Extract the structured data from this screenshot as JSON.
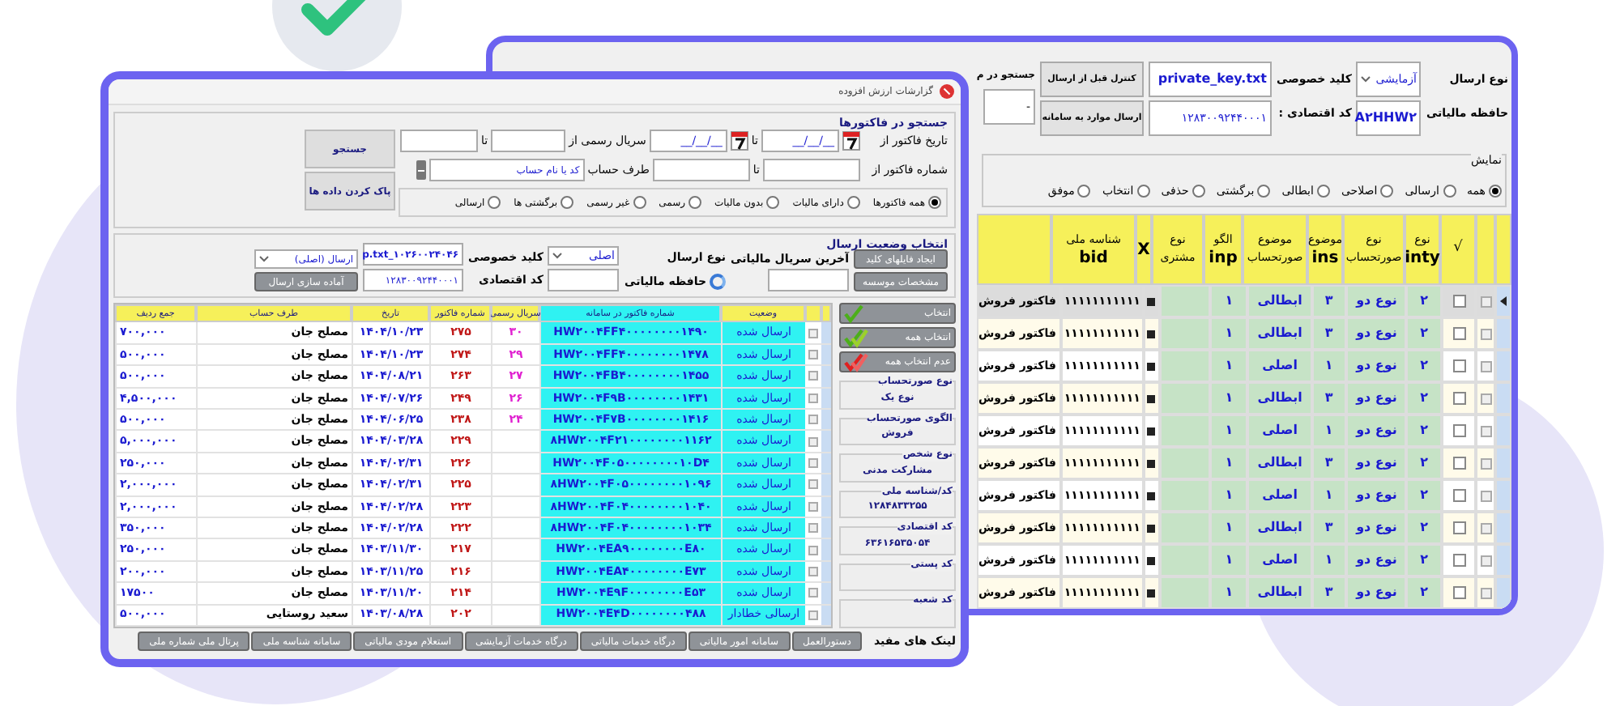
{
  "back_window": {
    "send_type": {
      "label": "نوع ارسال",
      "value": "آزمایشی"
    },
    "tax_memory": {
      "label": "حافظه مالیاتی",
      "value": "A۲HHW۲"
    },
    "private_key": {
      "label": "کلید خصوصی",
      "value": "private_key.txt"
    },
    "economic_code": {
      "label": "کد اقتصادی :",
      "value": "۱۲۸۳۰۰۹۲۴۴۰۰۰۱"
    },
    "buttons": [
      "کنترل قبل از ارسال",
      "ارسال موارد به سامانه"
    ],
    "search": {
      "label": "جستجو در م",
      "value": "-"
    },
    "display": {
      "title": "نمایش",
      "options": [
        {
          "label": "همه",
          "selected": true
        },
        {
          "label": "ارسالی",
          "selected": false
        },
        {
          "label": "اصلاحی",
          "selected": false
        },
        {
          "label": "ابطالی",
          "selected": false
        },
        {
          "label": "برگشتی",
          "selected": false
        },
        {
          "label": "حذفی",
          "selected": false
        },
        {
          "label": "انتخاب",
          "selected": false
        },
        {
          "label": "موفق",
          "selected": false
        }
      ]
    },
    "table": {
      "check_header": "√",
      "columns": [
        {
          "line1": "نوع",
          "code": "inty"
        },
        {
          "line1": "نوع",
          "line2": "صورتحساب"
        },
        {
          "line1": "موضوع",
          "code": "ins"
        },
        {
          "line1": "موضوع",
          "line2": "صورتحساب"
        },
        {
          "line1": "الگو",
          "code": "inp"
        },
        {
          "line1": "نوع",
          "line2": "مشتری"
        },
        {
          "code": "X"
        },
        {
          "line1": "شناسه ملی",
          "code": "bid"
        }
      ],
      "rows": [
        {
          "selected": true,
          "checked": false,
          "cells": [
            "۲",
            "نوع دو",
            "۳",
            "ابطالی",
            "۱",
            "",
            "",
            "۱۱۱۱۱۱۱۱۱۱۱",
            "فاکتور فروش"
          ]
        },
        {
          "selected": false,
          "checked": false,
          "cells": [
            "۲",
            "نوع دو",
            "۳",
            "ابطالی",
            "۱",
            "",
            "",
            "۱۱۱۱۱۱۱۱۱۱۱",
            "فاکتور فروش"
          ]
        },
        {
          "selected": false,
          "checked": false,
          "cells": [
            "۲",
            "نوع دو",
            "۱",
            "اصلی",
            "۱",
            "",
            "",
            "۱۱۱۱۱۱۱۱۱۱۱",
            "فاکتور فروش"
          ]
        },
        {
          "selected": false,
          "checked": false,
          "cells": [
            "۲",
            "نوع دو",
            "۳",
            "ابطالی",
            "۱",
            "",
            "",
            "۱۱۱۱۱۱۱۱۱۱۱",
            "فاکتور فروش"
          ]
        },
        {
          "selected": false,
          "checked": false,
          "cells": [
            "۲",
            "نوع دو",
            "۱",
            "اصلی",
            "۱",
            "",
            "",
            "۱۱۱۱۱۱۱۱۱۱۱",
            "فاکتور فروش"
          ]
        },
        {
          "selected": false,
          "checked": false,
          "cells": [
            "۲",
            "نوع دو",
            "۳",
            "ابطالی",
            "۱",
            "",
            "",
            "۱۱۱۱۱۱۱۱۱۱۱",
            "فاکتور فروش"
          ]
        },
        {
          "selected": false,
          "checked": false,
          "cells": [
            "۲",
            "نوع دو",
            "۱",
            "اصلی",
            "۱",
            "",
            "",
            "۱۱۱۱۱۱۱۱۱۱۱",
            "فاکتور فروش"
          ]
        },
        {
          "selected": false,
          "checked": false,
          "cells": [
            "۲",
            "نوع دو",
            "۳",
            "ابطالی",
            "۱",
            "",
            "",
            "۱۱۱۱۱۱۱۱۱۱۱",
            "فاکتور فروش"
          ]
        },
        {
          "selected": false,
          "checked": false,
          "cells": [
            "۲",
            "نوع دو",
            "۱",
            "اصلی",
            "۱",
            "",
            "",
            "۱۱۱۱۱۱۱۱۱۱۱",
            "فاکتور فروش"
          ]
        },
        {
          "selected": false,
          "checked": false,
          "cells": [
            "۲",
            "نوع دو",
            "۳",
            "ابطالی",
            "۱",
            "",
            "",
            "۱۱۱۱۱۱۱۱۱۱۱",
            "فاکتور فروش"
          ]
        }
      ]
    }
  },
  "front_window": {
    "title": "گزارشات ارزش افزوده",
    "search": {
      "title": "جستجو در فاکتورها",
      "date_from": {
        "label": "تاریخ فاکتور از",
        "value": "__/__/__"
      },
      "date_to": {
        "label": "تا",
        "value": "__/__/__"
      },
      "serial_from": {
        "label": "سریال رسمی از"
      },
      "serial_to": {
        "label": "تا"
      },
      "number_from": {
        "label": "شماره فاکتور از"
      },
      "number_to": {
        "label": "تا"
      },
      "account": {
        "label": "طرف حساب",
        "value": "کد یا نام حساب"
      },
      "options": [
        {
          "label": "همه فاکتورها",
          "selected": true
        },
        {
          "label": "دارای مالیات",
          "selected": false
        },
        {
          "label": "بدون مالیات",
          "selected": false
        },
        {
          "label": "رسمی",
          "selected": false
        },
        {
          "label": "غیر رسمی",
          "selected": false
        },
        {
          "label": "برگشتی ها",
          "selected": false
        },
        {
          "label": "ارسالی",
          "selected": false
        }
      ],
      "buttons": [
        "جستجو",
        "پاک کردن داده ها"
      ]
    },
    "send": {
      "title": "انتخاب وضعیت ارسال",
      "buttons": [
        "ایجاد فایلهای کلید",
        "مشخصات موسسه"
      ],
      "last_serial": {
        "label": "آخرین سریال مالیاتی"
      },
      "send_type": {
        "label": "نوع ارسال",
        "value": "اصلی"
      },
      "tax_memory": {
        "label": "حافظه مالیاتی"
      },
      "private_key": {
        "label": "کلید خصوصی",
        "value": "p.txt_۱۰۲۶۰۰۲۴۰۴۶"
      },
      "economic_code": {
        "label": "کد اقتصادی",
        "value": "۱۲۸۳۰۰۹۲۴۴۰۰۰۱"
      },
      "mode": {
        "value": "ارسال (اصلی)"
      },
      "prepare_button": "آماده سازی ارسال"
    },
    "side_buttons": [
      {
        "label": "انتخاب",
        "kind": "check"
      },
      {
        "label": "انتخاب همه",
        "kind": "check_all"
      },
      {
        "label": "عدم انتخاب همه",
        "kind": "uncheck_all"
      }
    ],
    "info": [
      {
        "label": "نوع صورتحساب",
        "value": "نوع یک"
      },
      {
        "label": "الگوی صورتحساب",
        "value": "فروش"
      },
      {
        "label": "نوع شخص",
        "value": "مشارکت مدنی"
      },
      {
        "label": "کد/شناسه ملی",
        "value": "۱۲۸۴۸۳۳۲۵۵"
      },
      {
        "label": "کد اقتصادی",
        "value": "۶۳۶۱۶۵۳۵۰۵۴"
      },
      {
        "label": "کد پستی"
      },
      {
        "label": "کد شعبه"
      }
    ],
    "table": {
      "columns": [
        "وضعیت",
        "شماره فاکتور در سامانه",
        "سریال رسمی",
        "شماره فاکتور",
        "تاریخ",
        "طرف حساب",
        "جمع ردیف"
      ],
      "rows": [
        [
          "ارسال شده",
          "HW۲۰۰۴FF۴۰۰۰۰۰۰۰۰۱۴۹۰",
          "۳۰",
          "۲۷۵",
          "۱۴۰۴/۱۰/۲۳",
          "مصلح جان",
          "۷۰۰,۰۰۰"
        ],
        [
          "ارسال شده",
          "HW۲۰۰۴FF۴۰۰۰۰۰۰۰۰۱۴۷۸",
          "۲۹",
          "۲۷۴",
          "۱۴۰۴/۱۰/۲۳",
          "مصلح جان",
          "۵۰۰,۰۰۰"
        ],
        [
          "ارسال شده",
          "HW۲۰۰۴FB۴۰۰۰۰۰۰۰۰۱۴۵۵",
          "۲۷",
          "۲۶۳",
          "۱۴۰۴/۰۸/۲۱",
          "مصلح جان",
          "۵۰۰,۰۰۰"
        ],
        [
          "ارسال شده",
          "HW۲۰۰۴F۹B۰۰۰۰۰۰۰۰۱۴۳۱",
          "۲۶",
          "۲۴۹",
          "۱۴۰۴/۰۷/۲۶",
          "مصلح جان",
          "۴,۵۰۰,۰۰۰"
        ],
        [
          "ارسال شده",
          "HW۲۰۰۴F۷B۰۰۰۰۰۰۰۰۱۴۱۶",
          "۲۴",
          "۲۳۸",
          "۱۴۰۴/۰۶/۲۵",
          "مصلح جان",
          "۵۰۰,۰۰۰"
        ],
        [
          "ارسال شده",
          "۸HW۲۰۰۴F۲۱۰۰۰۰۰۰۰۰۱۱۶۲",
          "",
          "۲۲۹",
          "۱۴۰۴/۰۳/۲۸",
          "مصلح جان",
          "۵,۰۰۰,۰۰۰"
        ],
        [
          "ارسال شده",
          "HW۲۰۰۴F۰۵۰۰۰۰۰۰۰۰۱۰D۴",
          "",
          "۲۲۶",
          "۱۴۰۴/۰۲/۳۱",
          "مصلح جان",
          "۲۵۰,۰۰۰"
        ],
        [
          "ارسال شده",
          "۸HW۲۰۰۴F۰۵۰۰۰۰۰۰۰۰۱۰۹۶",
          "",
          "۲۲۵",
          "۱۴۰۴/۰۲/۳۱",
          "مصلح جان",
          "۲,۰۰۰,۰۰۰"
        ],
        [
          "ارسال شده",
          "۸HW۲۰۰۴F۰۴۰۰۰۰۰۰۰۰۱۰۴۰",
          "",
          "۲۲۳",
          "۱۴۰۴/۰۲/۲۸",
          "مصلح جان",
          "۲,۰۰۰,۰۰۰"
        ],
        [
          "ارسال شده",
          "۸HW۲۰۰۴F۰۴۰۰۰۰۰۰۰۰۱۰۳۴",
          "",
          "۲۲۲",
          "۱۴۰۴/۰۲/۲۸",
          "مصلح جان",
          "۳۵۰,۰۰۰"
        ],
        [
          "ارسال شده",
          "HW۲۰۰۴EA۹۰۰۰۰۰۰۰۰E۸۰",
          "",
          "۲۱۷",
          "۱۴۰۳/۱۱/۳۰",
          "مصلح جان",
          "۲۵۰,۰۰۰"
        ],
        [
          "ارسال شده",
          "HW۲۰۰۴EA۴۰۰۰۰۰۰۰۰E۷۳",
          "",
          "۲۱۶",
          "۱۴۰۳/۱۱/۲۵",
          "مصلح جان",
          "۲۰۰,۰۰۰"
        ],
        [
          "ارسال شده",
          "HW۲۰۰۴E۹F۰۰۰۰۰۰۰۰E۵۳",
          "",
          "۲۱۴",
          "۱۴۰۳/۱۱/۲۰",
          "مصلح جان",
          "۱۷۵۰۰"
        ],
        [
          "ارسالی خطادار",
          "HW۲۰۰۴E۴D۰۰۰۰۰۰۰۰۴۸۸",
          "",
          "۲۰۲",
          "۱۴۰۳/۰۸/۲۸",
          "سعید روستایی",
          "۵۰۰,۰۰۰"
        ]
      ]
    },
    "links": {
      "title": "لینک های مفید",
      "buttons": [
        "دستورالعمل",
        "سامانه امور مالیاتی",
        "درگاه خدمات مالیاتی",
        "درگاه خدمات آزمایشی",
        "استعلام مودی مالیاتی",
        "سامانه شناسه ملی",
        "پرتال ملی شماره ملی"
      ]
    }
  }
}
